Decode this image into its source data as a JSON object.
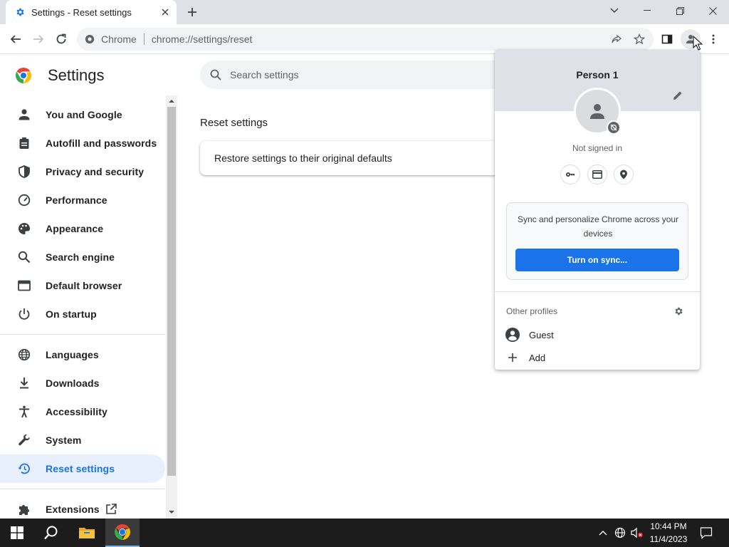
{
  "tab": {
    "title": "Settings - Reset settings",
    "favicon": "gear-icon"
  },
  "window": {
    "controls": [
      "chevron-down-icon",
      "minimize-icon",
      "restore-icon",
      "close-icon"
    ]
  },
  "omnibox": {
    "site_label": "Chrome",
    "url": "chrome://settings/reset"
  },
  "settings": {
    "title": "Settings",
    "search_placeholder": "Search settings",
    "nav": [
      {
        "label": "You and Google",
        "icon": "person-icon"
      },
      {
        "label": "Autofill and passwords",
        "icon": "clipboard-icon"
      },
      {
        "label": "Privacy and security",
        "icon": "shield-icon"
      },
      {
        "label": "Performance",
        "icon": "speedometer-icon"
      },
      {
        "label": "Appearance",
        "icon": "palette-icon"
      },
      {
        "label": "Search engine",
        "icon": "search-icon"
      },
      {
        "label": "Default browser",
        "icon": "browser-icon"
      },
      {
        "label": "On startup",
        "icon": "power-icon"
      },
      {
        "label": "Languages",
        "icon": "globe-icon"
      },
      {
        "label": "Downloads",
        "icon": "download-icon"
      },
      {
        "label": "Accessibility",
        "icon": "accessibility-icon"
      },
      {
        "label": "System",
        "icon": "wrench-icon"
      },
      {
        "label": "Reset settings",
        "icon": "history-icon",
        "active": true
      },
      {
        "label": "Extensions",
        "icon": "puzzle-icon"
      }
    ],
    "section_title": "Reset settings",
    "card_text": "Restore settings to their original defaults"
  },
  "profile": {
    "name": "Person 1",
    "status": "Not signed in",
    "sync_message": "Sync and personalize Chrome across your devices",
    "sync_button": "Turn on sync...",
    "other_profiles": "Other profiles",
    "guest": "Guest",
    "add": "Add"
  },
  "taskbar": {
    "time": "10:44 PM",
    "date": "11/4/2023"
  },
  "colors": {
    "accent": "#1a73e8",
    "active_nav_bg": "#e8f0fe"
  }
}
